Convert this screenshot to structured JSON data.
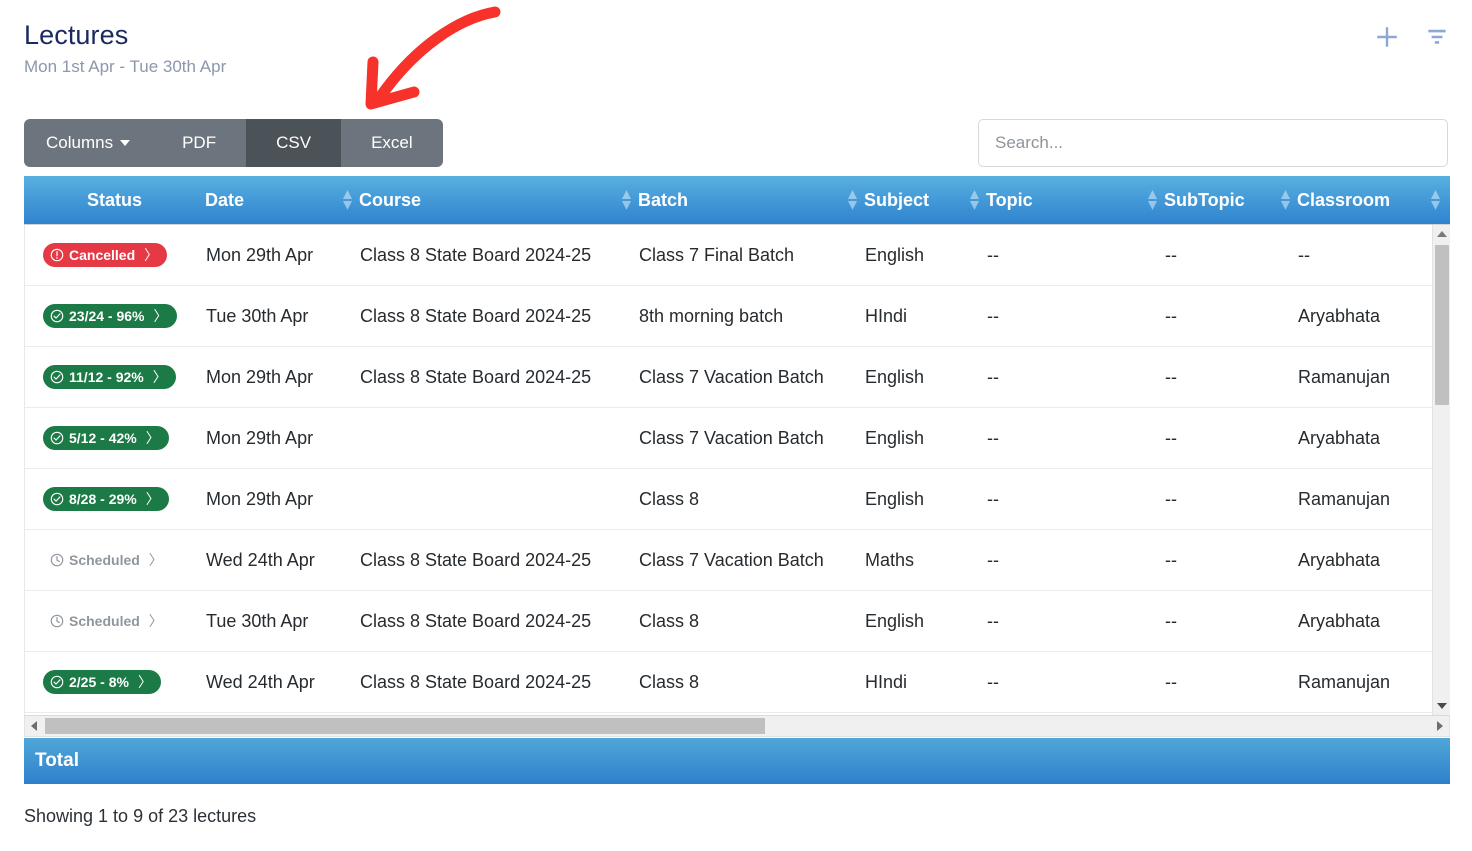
{
  "header": {
    "title": "Lectures",
    "subtitle": "Mon 1st Apr - Tue 30th Apr",
    "add_icon": "plus-icon",
    "filter_icon": "filter-icon"
  },
  "toolbar": {
    "columns_label": "Columns",
    "pdf_label": "PDF",
    "csv_label": "CSV",
    "excel_label": "Excel",
    "active_button": "CSV"
  },
  "search": {
    "placeholder": "Search...",
    "value": ""
  },
  "table": {
    "columns": [
      {
        "key": "status",
        "label": "Status",
        "sortable": false
      },
      {
        "key": "date",
        "label": "Date",
        "sortable": true
      },
      {
        "key": "course",
        "label": "Course",
        "sortable": true
      },
      {
        "key": "batch",
        "label": "Batch",
        "sortable": true
      },
      {
        "key": "subject",
        "label": "Subject",
        "sortable": true
      },
      {
        "key": "topic",
        "label": "Topic",
        "sortable": true
      },
      {
        "key": "subtopic",
        "label": "SubTopic",
        "sortable": true
      },
      {
        "key": "classroom",
        "label": "Classroom",
        "sortable": true
      }
    ],
    "rows": [
      {
        "status": {
          "type": "cancelled",
          "label": "Cancelled",
          "icon": "exclamation-circle-icon"
        },
        "date": "Mon 29th Apr",
        "course": "Class 8 State Board 2024-25",
        "batch": "Class 7 Final Batch",
        "subject": "English",
        "topic": "--",
        "subtopic": "--",
        "classroom": "--"
      },
      {
        "status": {
          "type": "done",
          "label": "23/24 - 96%",
          "icon": "check-circle-icon"
        },
        "date": "Tue 30th Apr",
        "course": "Class 8 State Board 2024-25",
        "batch": "8th morning batch",
        "subject": "HIndi",
        "topic": "--",
        "subtopic": "--",
        "classroom": "Aryabhata"
      },
      {
        "status": {
          "type": "done",
          "label": "11/12 - 92%",
          "icon": "check-circle-icon"
        },
        "date": "Mon 29th Apr",
        "course": "Class 8 State Board 2024-25",
        "batch": "Class 7 Vacation Batch",
        "subject": "English",
        "topic": "--",
        "subtopic": "--",
        "classroom": "Ramanujan"
      },
      {
        "status": {
          "type": "done",
          "label": "5/12 - 42%",
          "icon": "check-circle-icon"
        },
        "date": "Mon 29th Apr",
        "course": "",
        "batch": "Class 7 Vacation Batch",
        "subject": "English",
        "topic": "--",
        "subtopic": "--",
        "classroom": "Aryabhata"
      },
      {
        "status": {
          "type": "done",
          "label": "8/28 - 29%",
          "icon": "check-circle-icon"
        },
        "date": "Mon 29th Apr",
        "course": "",
        "batch": "Class 8",
        "subject": "English",
        "topic": "--",
        "subtopic": "--",
        "classroom": "Ramanujan"
      },
      {
        "status": {
          "type": "scheduled",
          "label": "Scheduled",
          "icon": "clock-icon"
        },
        "date": "Wed 24th Apr",
        "course": "Class 8 State Board 2024-25",
        "batch": "Class 7 Vacation Batch",
        "subject": "Maths",
        "topic": "--",
        "subtopic": "--",
        "classroom": "Aryabhata"
      },
      {
        "status": {
          "type": "scheduled",
          "label": "Scheduled",
          "icon": "clock-icon"
        },
        "date": "Tue 30th Apr",
        "course": "Class 8 State Board 2024-25",
        "batch": "Class 8",
        "subject": "English",
        "topic": "--",
        "subtopic": "--",
        "classroom": "Aryabhata"
      },
      {
        "status": {
          "type": "done",
          "label": "2/25 - 8%",
          "icon": "check-circle-icon"
        },
        "date": "Wed 24th Apr",
        "course": "Class 8 State Board 2024-25",
        "batch": "Class 8",
        "subject": "HIndi",
        "topic": "--",
        "subtopic": "--",
        "classroom": "Ramanujan"
      }
    ],
    "total_label": "Total"
  },
  "footer": {
    "showing_text": "Showing 1 to 9 of 23 lectures"
  },
  "annotation": {
    "type": "arrow",
    "color": "#f6322a",
    "points_to": "CSV"
  },
  "colors": {
    "header_blue_top": "#58b0e0",
    "header_blue_bottom": "#2f83cf",
    "badge_red": "#e63946",
    "badge_green": "#1b7a45",
    "btn_grey": "#6c757d",
    "btn_active_grey": "#4b5258",
    "title_navy": "#1b2a5e",
    "subtitle_grey": "#8c96ad"
  }
}
